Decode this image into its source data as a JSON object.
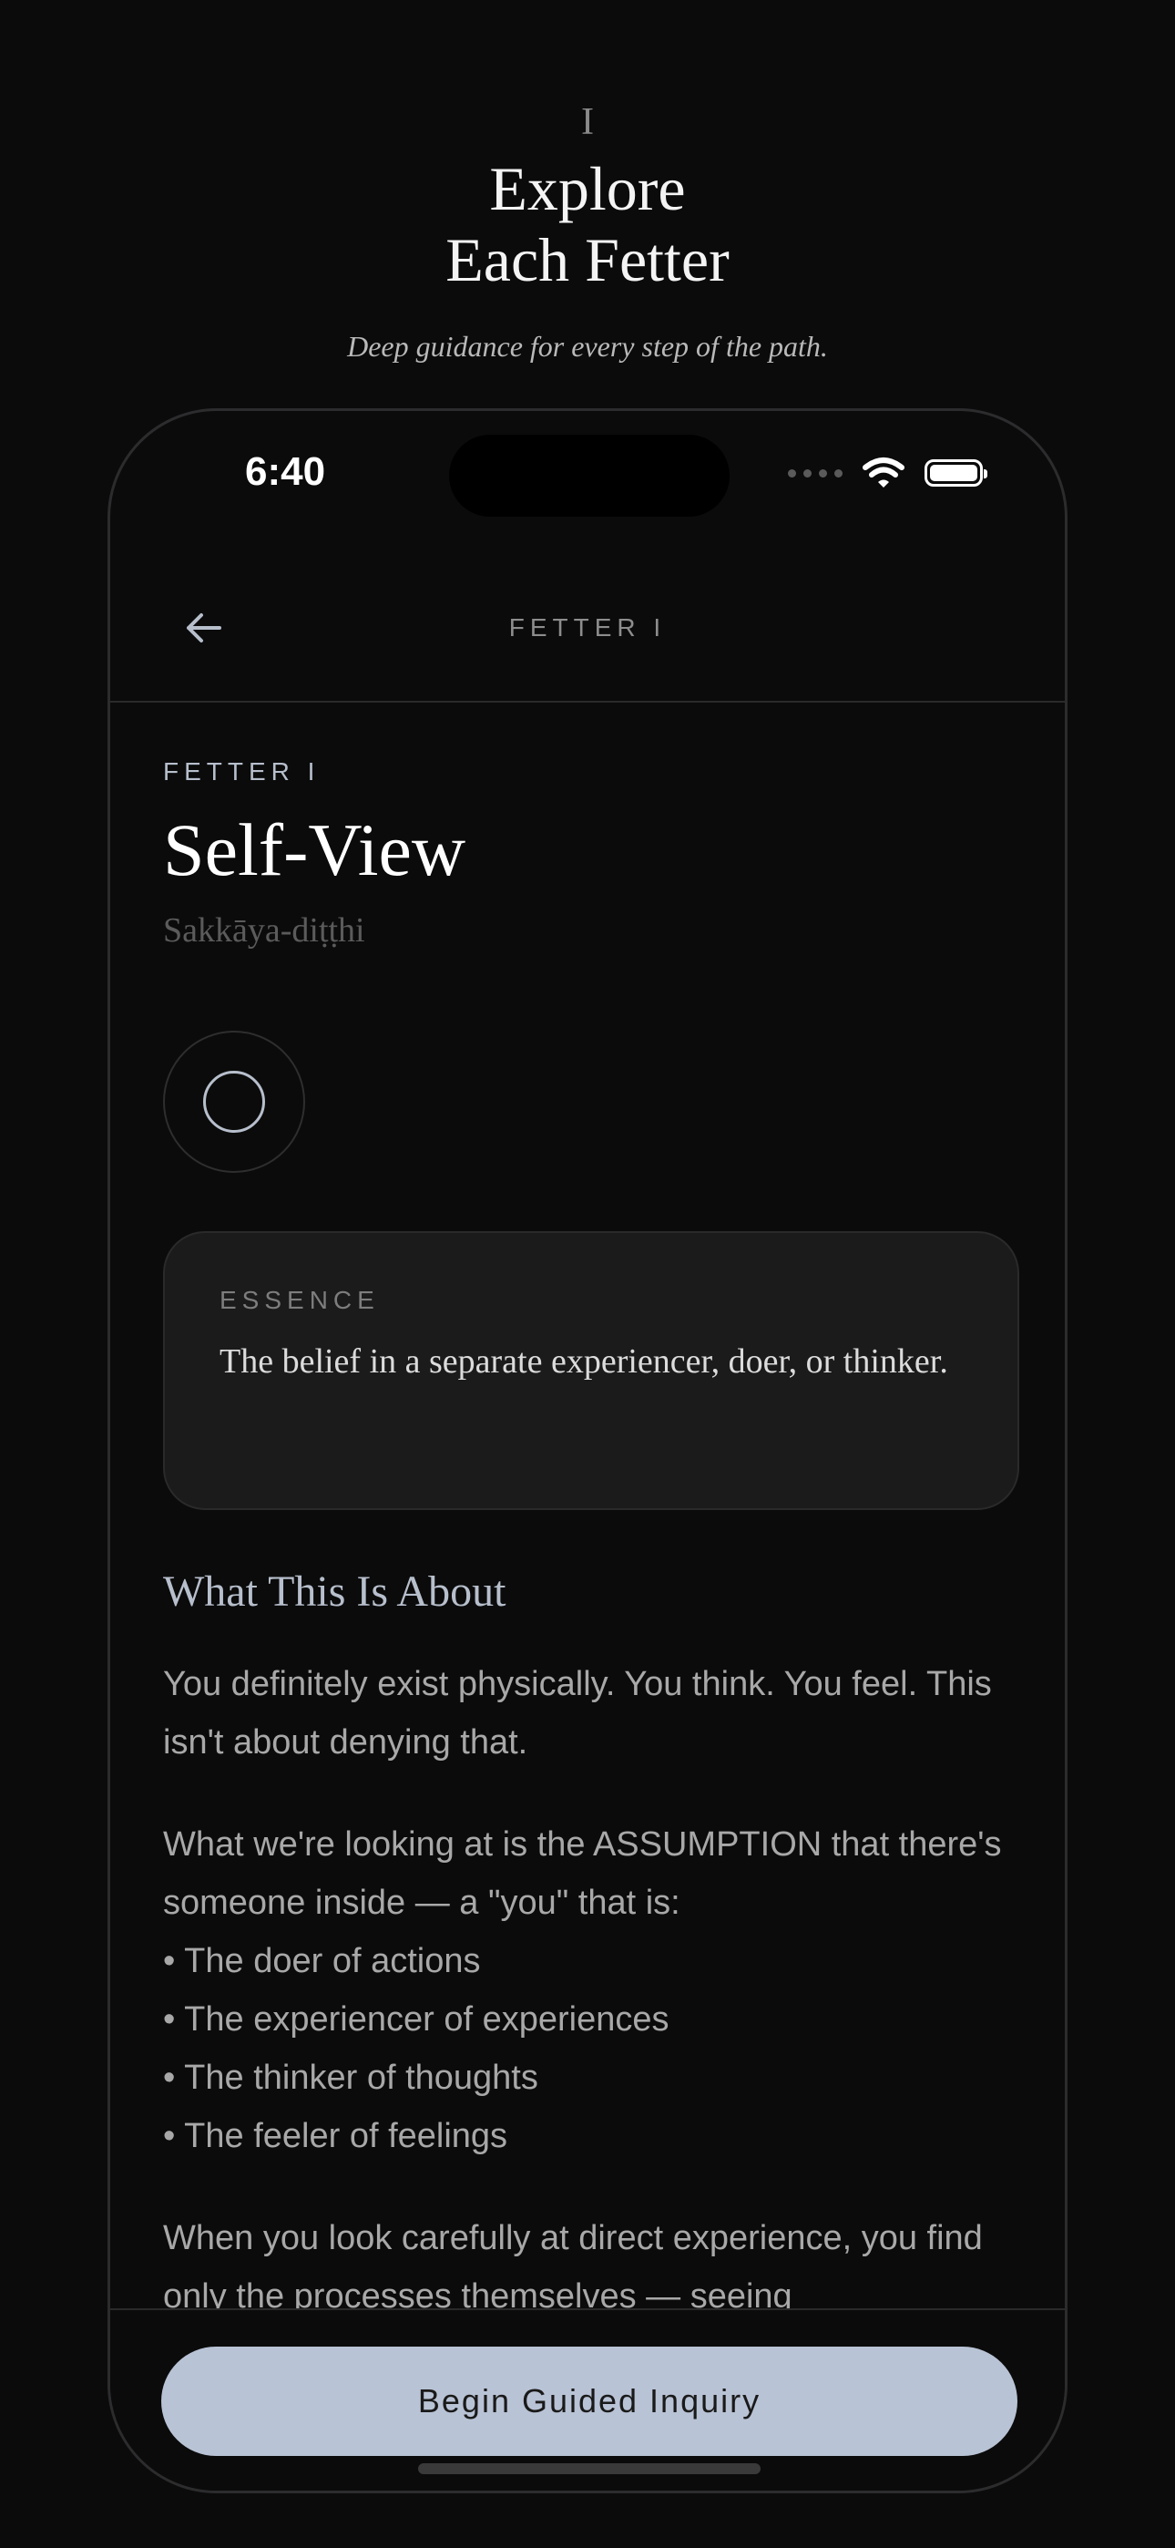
{
  "hero": {
    "numeral": "I",
    "title_line1": "Explore",
    "title_line2": "Each Fetter",
    "subtitle": "Deep guidance for every step of the path."
  },
  "status_bar": {
    "time": "6:40",
    "icons": [
      "signal-dots-icon",
      "wifi-icon",
      "battery-icon"
    ]
  },
  "nav": {
    "back_icon": "arrow-left-icon",
    "title": "FETTER I"
  },
  "fetter": {
    "eyebrow": "FETTER I",
    "title": "Self-View",
    "pali": "Sakkāya-diṭṭhi",
    "symbol_icon": "circle-icon"
  },
  "essence": {
    "label": "ESSENCE",
    "text": "The belief in a separate experiencer, doer, or thinker."
  },
  "about": {
    "heading": "What This Is About",
    "paragraph1": "You definitely exist physically. You think. You feel. This isn't about denying that.",
    "paragraph2": "What we're looking at is the ASSUMPTION that there's someone inside — a \"you\" that is:",
    "bullets": [
      "• The doer of actions",
      "• The experiencer of experiences",
      "• The thinker of thoughts",
      "• The feeler of feelings"
    ],
    "paragraph3": "When you look carefully at direct experience, you find only the processes themselves — seeing"
  },
  "cta": {
    "label": "Begin Guided Inquiry"
  },
  "colors": {
    "background": "#0b0b0b",
    "accent": "#b8c3d5",
    "card": "#1b1b1b"
  }
}
